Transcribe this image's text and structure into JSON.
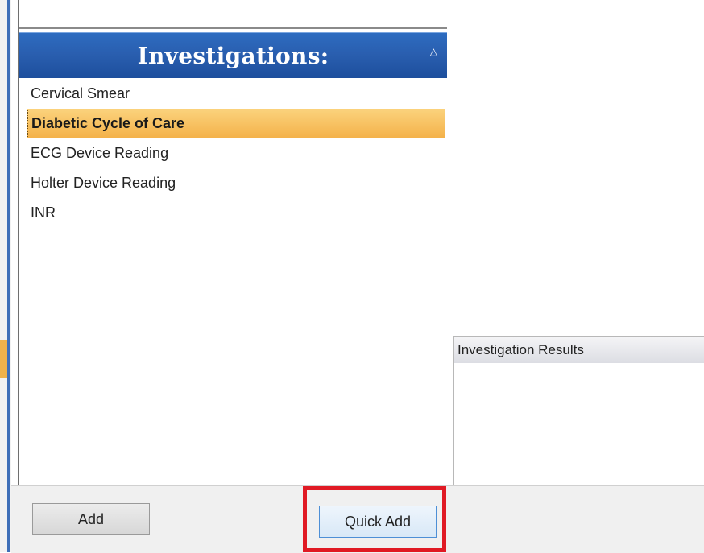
{
  "investigations": {
    "title": "Investigations:",
    "sort_icon": "sort-ascending-icon",
    "items": [
      {
        "label": "Cervical Smear",
        "selected": false
      },
      {
        "label": "Diabetic Cycle of Care",
        "selected": true
      },
      {
        "label": "ECG Device Reading",
        "selected": false
      },
      {
        "label": "Holter Device Reading",
        "selected": false
      },
      {
        "label": "INR",
        "selected": false
      }
    ]
  },
  "results": {
    "header_label": "Investigation Results"
  },
  "buttons": {
    "add_label": "Add",
    "quick_add_label": "Quick Add"
  },
  "colors": {
    "header_blue": "#2a5fb0",
    "selected_orange": "#f4b24a",
    "highlight_red": "#e01a24"
  }
}
